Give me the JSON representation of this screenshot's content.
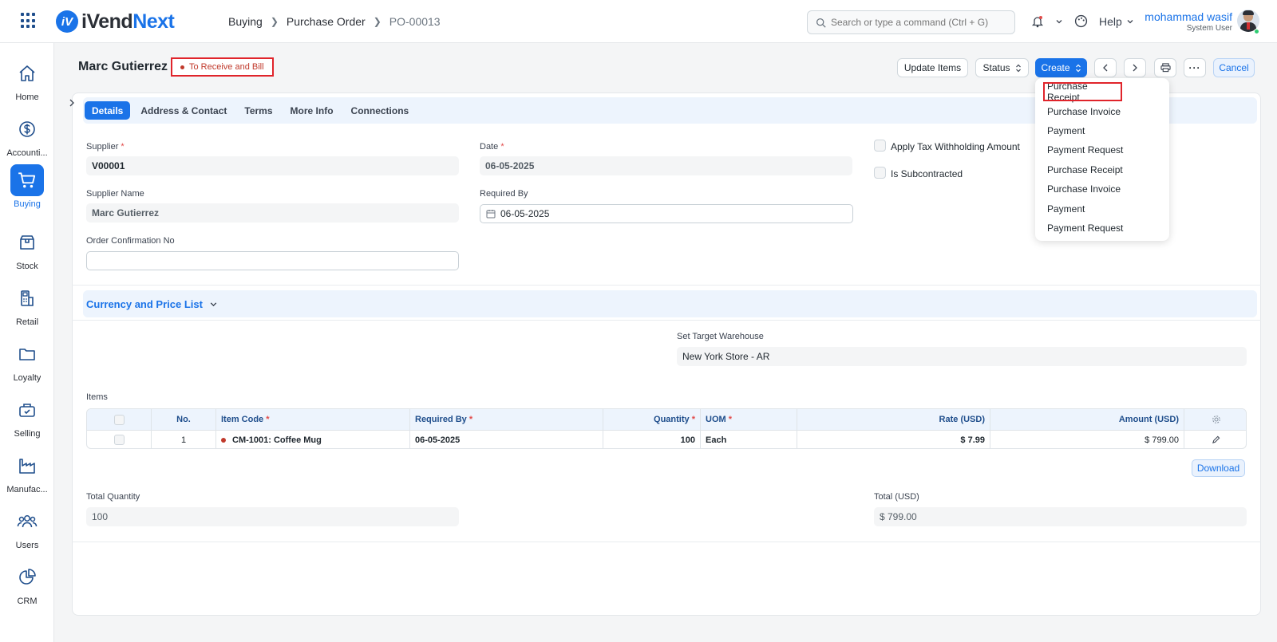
{
  "app": {
    "brand_prefix": "iVend",
    "brand_suffix": "Next"
  },
  "breadcrumb": {
    "items": [
      "Buying",
      "Purchase Order",
      "PO-00013"
    ]
  },
  "search": {
    "placeholder": "Search or type a command (Ctrl + G)"
  },
  "topbar": {
    "help_label": "Help",
    "user_name": "mohammad wasif",
    "user_role": "System User"
  },
  "sidebar": {
    "items": [
      {
        "label": "Home",
        "icon": "home-icon"
      },
      {
        "label": "Accounti...",
        "icon": "dollar-icon"
      },
      {
        "label": "Buying",
        "icon": "cart-icon",
        "active": true
      },
      {
        "label": "Stock",
        "icon": "box-icon"
      },
      {
        "label": "Retail",
        "icon": "retail-icon"
      },
      {
        "label": "Loyalty",
        "icon": "folder-icon"
      },
      {
        "label": "Selling",
        "icon": "basket-icon"
      },
      {
        "label": "Manufac...",
        "icon": "factory-icon"
      },
      {
        "label": "Users",
        "icon": "users-icon"
      },
      {
        "label": "CRM",
        "icon": "pie-chart-icon"
      }
    ]
  },
  "header": {
    "title": "Marc Gutierrez",
    "status": "To Receive and Bill",
    "update_items_label": "Update Items",
    "status_label": "Status",
    "create_label": "Create",
    "cancel_label": "Cancel"
  },
  "create_menu": {
    "items": [
      "Purchase Receipt",
      "Purchase Invoice",
      "Payment",
      "Payment Request",
      "Purchase Receipt",
      "Purchase Invoice",
      "Payment",
      "Payment Request"
    ]
  },
  "tabs": [
    "Details",
    "Address & Contact",
    "Terms",
    "More Info",
    "Connections"
  ],
  "form": {
    "supplier_label": "Supplier",
    "supplier_value": "V00001",
    "supplier_name_label": "Supplier Name",
    "supplier_name_value": "Marc Gutierrez",
    "order_conf_label": "Order Confirmation No",
    "order_conf_value": "",
    "date_label": "Date",
    "date_value": "06-05-2025",
    "required_by_label": "Required By",
    "required_by_value": "06-05-2025",
    "tax_withholding_label": "Apply Tax Withholding Amount",
    "subcontracted_label": "Is Subcontracted"
  },
  "currency_section": {
    "title": "Currency and Price List"
  },
  "warehouse": {
    "label": "Set Target Warehouse",
    "value": "New York Store - AR"
  },
  "items": {
    "label": "Items",
    "columns": [
      "No.",
      "Item Code",
      "Required By",
      "Quantity",
      "UOM",
      "Rate (USD)",
      "Amount (USD)"
    ],
    "rows": [
      {
        "no": "1",
        "item_code": "CM-1001: Coffee Mug",
        "required_by": "06-05-2025",
        "quantity": "100",
        "uom": "Each",
        "rate": "$ 7.99",
        "amount": "$ 799.00"
      }
    ],
    "download_label": "Download"
  },
  "totals": {
    "total_qty_label": "Total Quantity",
    "total_qty_value": "100",
    "total_label": "Total (USD)",
    "total_value": "$ 799.00"
  },
  "colors": {
    "accent": "#1a73e8",
    "status": "#c0392b",
    "highlight_border": "#e0242b"
  }
}
